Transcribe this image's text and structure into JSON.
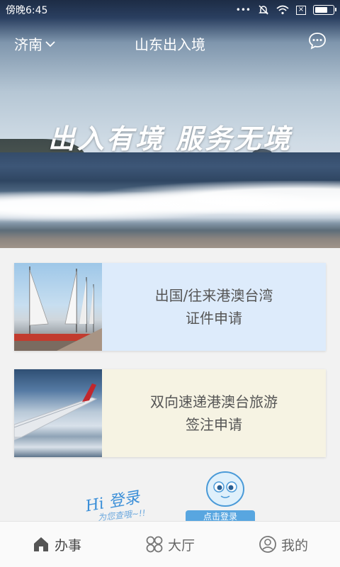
{
  "status_bar": {
    "time": "傍晚6:45",
    "dots": "•••"
  },
  "header": {
    "city": "济南",
    "title": "山东出入境"
  },
  "hero": {
    "slogan": "出入有境 服务无境"
  },
  "cards": [
    {
      "line1": "出国/往来港澳台湾",
      "line2": "证件申请"
    },
    {
      "line1": "双向速递港澳台旅游",
      "line2": "签注申请"
    }
  ],
  "promo": {
    "hi_text": "Hi 登录",
    "sub_text": "为您查哦~!!",
    "login_label": "点击登录"
  },
  "bottom_nav": [
    {
      "label": "办事",
      "icon": "home-icon",
      "active": true
    },
    {
      "label": "大厅",
      "icon": "grid-icon",
      "active": false
    },
    {
      "label": "我的",
      "icon": "user-icon",
      "active": false
    }
  ],
  "colors": {
    "card1_bg": "#ddebfb",
    "card2_bg": "#f6f3e3",
    "accent": "#3b8fd8"
  }
}
